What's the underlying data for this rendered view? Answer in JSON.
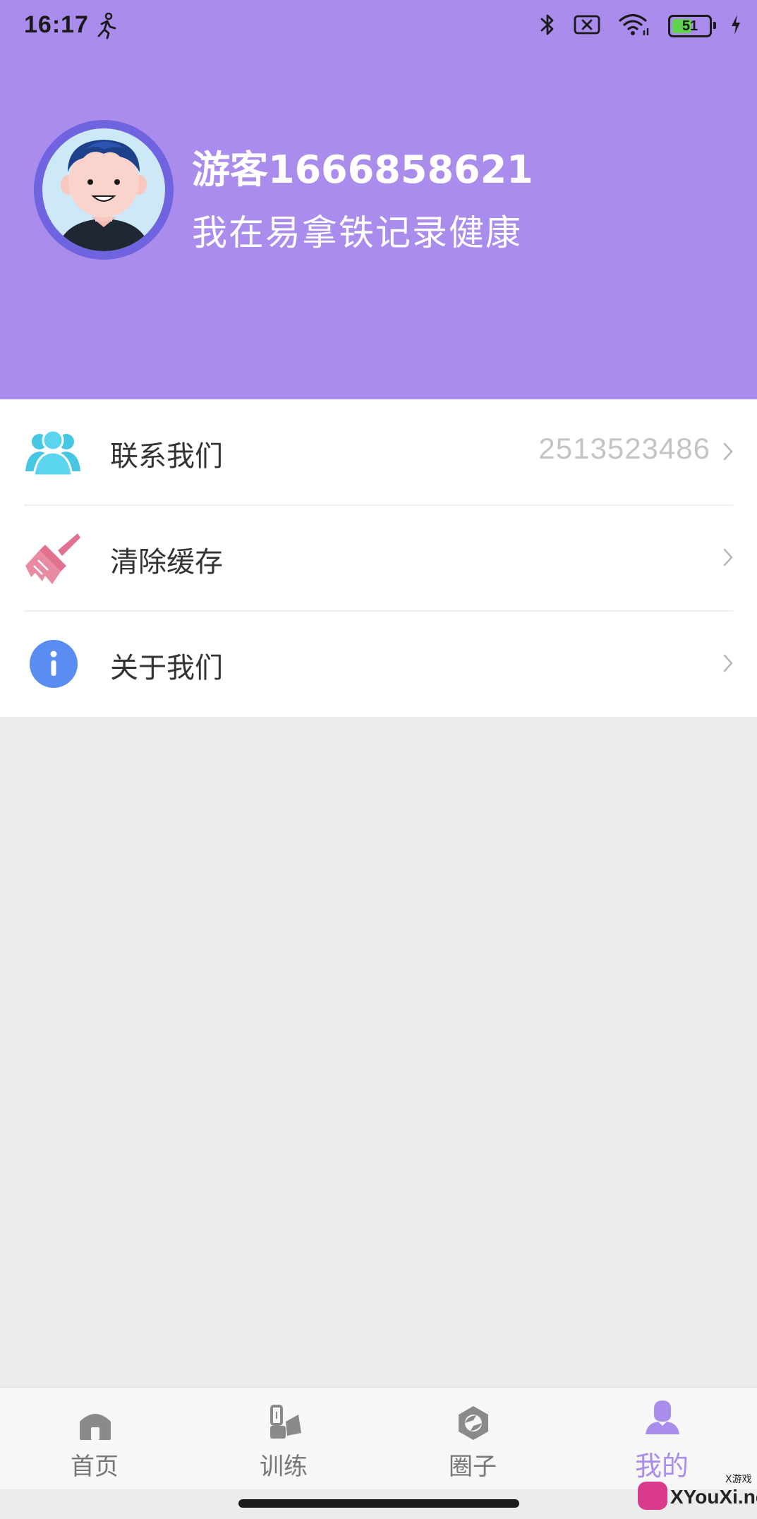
{
  "status_bar": {
    "time": "16:17",
    "battery_level": "51",
    "icons": [
      "running-man-icon",
      "bluetooth-icon",
      "sim-off-icon",
      "wifi-icon",
      "battery-icon",
      "charging-bolt-icon"
    ]
  },
  "colors": {
    "header_bg": "#a98cec",
    "accent": "#a98cec",
    "page_bg": "#ececec",
    "avatar_ring": "#6f63e0"
  },
  "profile": {
    "username": "游客1666858621",
    "motto": "我在易拿铁记录健康"
  },
  "menu": {
    "items": [
      {
        "label": "联系我们",
        "value": "2513523486",
        "icon": "contacts-group-icon"
      },
      {
        "label": "清除缓存",
        "value": "",
        "icon": "broom-icon"
      },
      {
        "label": "关于我们",
        "value": "",
        "icon": "info-icon"
      }
    ]
  },
  "bottom_nav": {
    "items": [
      {
        "label": "首页",
        "icon": "home-icon",
        "active": false
      },
      {
        "label": "训练",
        "icon": "training-icon",
        "active": false
      },
      {
        "label": "圈子",
        "icon": "circle-icon",
        "active": false
      },
      {
        "label": "我的",
        "icon": "profile-icon",
        "active": true
      }
    ]
  },
  "watermark": {
    "text": "XYouXi.net",
    "sub": "X游戏"
  }
}
